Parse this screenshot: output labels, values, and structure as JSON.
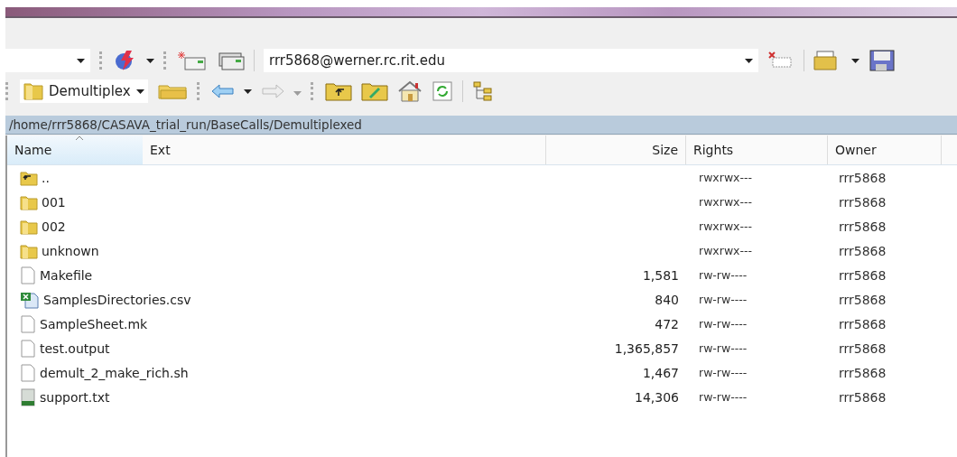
{
  "toolbar": {
    "host": "rrr5868@werner.rc.rit.edu"
  },
  "location": {
    "drive": "Demultiplex"
  },
  "path": "/home/rrr5868/CASAVA_trial_run/BaseCalls/Demultiplexed",
  "table": {
    "columns": [
      {
        "label": "Name",
        "sorted": true
      },
      {
        "label": "Ext",
        "sorted": false
      },
      {
        "label": "Size",
        "sorted": false
      },
      {
        "label": "Rights",
        "sorted": false
      },
      {
        "label": "Owner",
        "sorted": false
      }
    ],
    "rows": [
      {
        "kind": "parent",
        "name": "..",
        "size": "",
        "rights": "rwxrwx---",
        "owner": "rrr5868"
      },
      {
        "kind": "folder",
        "name": "001",
        "size": "",
        "rights": "rwxrwx---",
        "owner": "rrr5868"
      },
      {
        "kind": "folder",
        "name": "002",
        "size": "",
        "rights": "rwxrwx---",
        "owner": "rrr5868"
      },
      {
        "kind": "folder",
        "name": "unknown",
        "size": "",
        "rights": "rwxrwx---",
        "owner": "rrr5868"
      },
      {
        "kind": "file",
        "name": "Makefile",
        "size": "1,581",
        "rights": "rw-rw----",
        "owner": "rrr5868"
      },
      {
        "kind": "spreadsheet",
        "name": "SamplesDirectories.csv",
        "size": "840",
        "rights": "rw-rw----",
        "owner": "rrr5868"
      },
      {
        "kind": "file",
        "name": "SampleSheet.mk",
        "size": "472",
        "rights": "rw-rw----",
        "owner": "rrr5868"
      },
      {
        "kind": "file",
        "name": "test.output",
        "size": "1,365,857",
        "rights": "rw-rw----",
        "owner": "rrr5868"
      },
      {
        "kind": "file",
        "name": "demult_2_make_rich.sh",
        "size": "1,467",
        "rights": "rw-rw----",
        "owner": "rrr5868"
      },
      {
        "kind": "text",
        "name": "support.txt",
        "size": "14,306",
        "rights": "rw-rw----",
        "owner": "rrr5868"
      }
    ]
  }
}
